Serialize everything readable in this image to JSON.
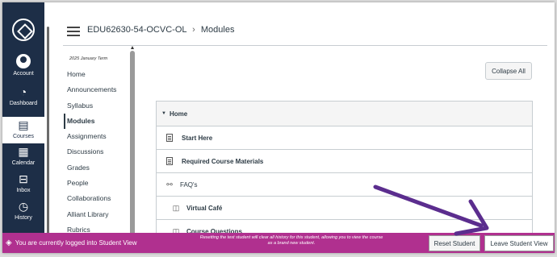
{
  "global_nav": {
    "logo_icon": "institution-logo",
    "items": [
      {
        "label": "Account",
        "icon": "user-avatar"
      },
      {
        "label": "Dashboard",
        "icon": "dashboard-gauge"
      },
      {
        "label": "Courses",
        "icon": "book"
      },
      {
        "label": "Calendar",
        "icon": "calendar"
      },
      {
        "label": "Inbox",
        "icon": "inbox-tray"
      },
      {
        "label": "History",
        "icon": "clock"
      }
    ]
  },
  "header": {
    "course_code": "EDU62630-54-OCVC-OL",
    "separator": "›",
    "current_page": "Modules"
  },
  "course_nav": {
    "term": "2025 January Term",
    "items": [
      {
        "label": "Home"
      },
      {
        "label": "Announcements"
      },
      {
        "label": "Syllabus"
      },
      {
        "label": "Modules"
      },
      {
        "label": "Assignments"
      },
      {
        "label": "Discussions"
      },
      {
        "label": "Grades"
      },
      {
        "label": "People"
      },
      {
        "label": "Collaborations"
      },
      {
        "label": "Alliant Library"
      },
      {
        "label": "Rubrics"
      }
    ]
  },
  "main": {
    "collapse_all_label": "Collapse All",
    "module": {
      "title": "Home",
      "items": [
        {
          "label": "Start Here",
          "icon": "page-icon"
        },
        {
          "label": "Required Course Materials",
          "icon": "page-icon"
        },
        {
          "label": "FAQ's",
          "icon": "link-icon"
        },
        {
          "label": "Virtual Café",
          "icon": "discussion-icon"
        },
        {
          "label": "Course Questions",
          "icon": "discussion-icon"
        }
      ]
    }
  },
  "student_view": {
    "message": "You are currently logged into Student View",
    "note": "Resetting the test student will clear all history for this student, allowing you to view the course as a brand new student.",
    "reset_label": "Reset Student",
    "leave_label": "Leave Student View",
    "bar_color": "#b0308f"
  },
  "annotation": {
    "arrow_color": "#5b2d8e"
  }
}
